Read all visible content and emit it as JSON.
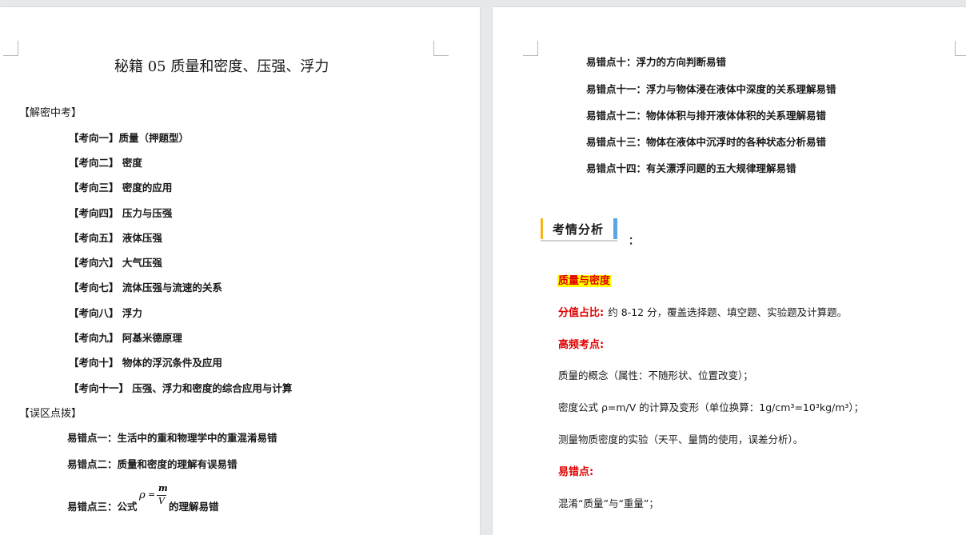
{
  "left_page": {
    "title": "秘籍 05 质量和密度、压强、浮力",
    "section_1": "【解密中考】",
    "directions": [
      "【考向一】质量（押题型）",
      "【考向二】 密度",
      "【考向三】 密度的应用",
      "【考向四】 压力与压强",
      "【考向五】 液体压强",
      "【考向六】 大气压强",
      "【考向七】 流体压强与流速的关系",
      "【考向八】 浮力",
      "【考向九】 阿基米德原理",
      "【考向十】 物体的浮沉条件及应用",
      "【考向十一】 压强、浮力和密度的综合应用与计算"
    ],
    "section_2": "【误区点拨】",
    "errors": [
      "易错点一：生活中的重和物理学中的重混淆易错",
      "易错点二：质量和密度的理解有误易错"
    ],
    "error_3_prefix": "易错点三：公式",
    "error_3_suffix": "的理解易错",
    "formula": {
      "lhs": "ρ",
      "eq": "=",
      "numerator": "m",
      "denominator": "V"
    }
  },
  "right_page": {
    "errors": [
      "易错点十：浮力的方向判断易错",
      "易错点十一：浮力与物体浸在液体中深度的关系理解易错",
      "易错点十二：物体体积与排开液体体积的关系理解易错",
      "易错点十三：物体在液体中沉浮时的各种状态分析易错",
      "易错点十四：有关漂浮问题的五大规律理解易错"
    ],
    "badge": "考情分析",
    "badge_colon": "：",
    "topic": "质量与密度",
    "score_label": "分值占比:",
    "score_text": "约 8-12 分，覆盖选择题、填空题、实验题及计算题。",
    "freq_label": "高频考点:",
    "points": [
      "质量的概念（属性：不随形状、位置改变）；",
      "密度公式 ρ=m/V 的计算及变形（单位换算：1g/cm³=10³kg/m³）；",
      "测量物质密度的实验（天平、量筒的使用，误差分析）。"
    ],
    "easy_label": "易错点:",
    "easy_first": "混淆“质量”与“重量”；"
  },
  "colors": {
    "highlight": "#ffff00",
    "red_text": "#e00000",
    "badge_left": "#f4b41a",
    "badge_right": "#5aa5e6"
  }
}
